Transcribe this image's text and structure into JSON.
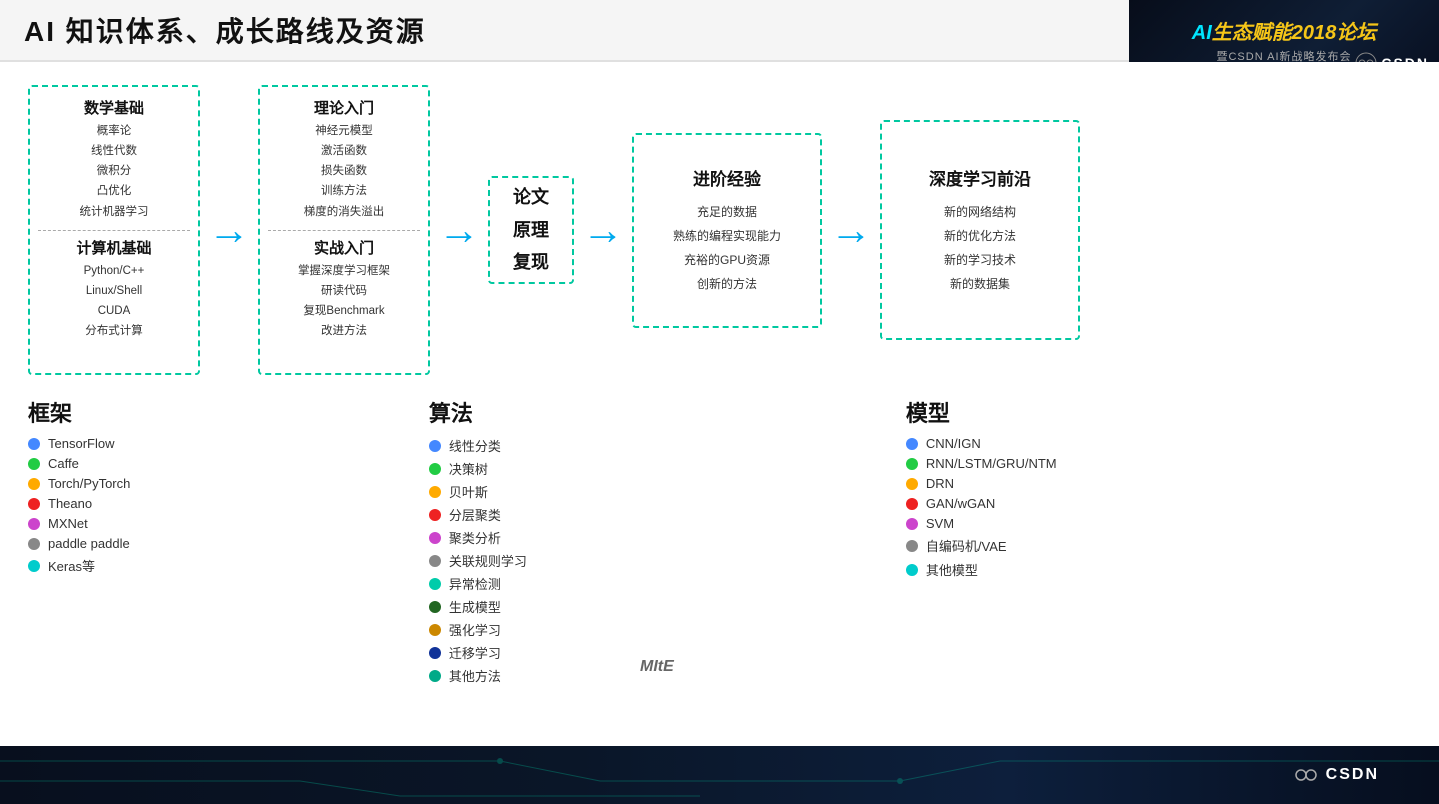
{
  "header": {
    "title": "AI 知识体系、成长路线及资源"
  },
  "logo": {
    "main_text": "AI生态赋能2018论坛",
    "sub_text": "暨CSDN AI新战略发布会",
    "ai_prefix": "AI",
    "year": "2018",
    "forum": "论坛",
    "eco": "生态赋能"
  },
  "flowchart": {
    "box1": {
      "title1": "数学基础",
      "items1": [
        "概率论",
        "线性代数",
        "微积分",
        "凸优化",
        "统计机器学习"
      ],
      "title2": "计算机基础",
      "items2": [
        "Python/C++",
        "Linux/Shell",
        "CUDA",
        "分布式计算"
      ]
    },
    "arrow1": "→",
    "box2": {
      "title1": "理论入门",
      "items1": [
        "神经元模型",
        "激活函数",
        "损失函数",
        "训练方法",
        "梯度的消失溢出"
      ],
      "title2": "实战入门",
      "items2": [
        "掌握深度学习框架",
        "研读代码",
        "复现Benchmark",
        "改进方法"
      ]
    },
    "arrow2": "→",
    "box3": {
      "text": "论文\n原理\n复现"
    },
    "arrow3": "→",
    "box4": {
      "title": "进阶经验",
      "items": [
        "充足的数据",
        "熟练的编程实现能力",
        "充裕的GPU资源",
        "创新的方法"
      ]
    },
    "arrow4": "→",
    "box5": {
      "title": "深度学习前沿",
      "items": [
        "新的网络结构",
        "新的优化方法",
        "新的学习技术",
        "新的数据集"
      ]
    }
  },
  "legend_frameworks": {
    "title": "框架",
    "items": [
      {
        "color": "blue",
        "label": "TensorFlow"
      },
      {
        "color": "green",
        "label": "Caffe"
      },
      {
        "color": "orange",
        "label": "Torch/PyTorch"
      },
      {
        "color": "red",
        "label": "Theano"
      },
      {
        "color": "purple",
        "label": "MXNet"
      },
      {
        "color": "gray",
        "label": "paddle paddle"
      },
      {
        "color": "teal",
        "label": "Keras等"
      }
    ]
  },
  "legend_algorithms": {
    "title": "算法",
    "items": [
      {
        "color": "blue",
        "label": "线性分类"
      },
      {
        "color": "green",
        "label": "决策树"
      },
      {
        "color": "orange",
        "label": "贝叶斯"
      },
      {
        "color": "red",
        "label": "分层聚类"
      },
      {
        "color": "purple",
        "label": "聚类分析"
      },
      {
        "color": "gray",
        "label": "关联规则学习"
      },
      {
        "color": "teal",
        "label": "异常检测"
      },
      {
        "color": "darkgreen",
        "label": "生成模型"
      },
      {
        "color": "darkorange",
        "label": "强化学习"
      },
      {
        "color": "darkblue",
        "label": "迁移学习"
      },
      {
        "color": "teal2",
        "label": "其他方法"
      }
    ]
  },
  "legend_models": {
    "title": "模型",
    "items": [
      {
        "color": "blue",
        "label": "CNN/IGN"
      },
      {
        "color": "green",
        "label": "RNN/LSTM/GRU/NTM"
      },
      {
        "color": "orange",
        "label": "DRN"
      },
      {
        "color": "red",
        "label": "GAN/wGAN"
      },
      {
        "color": "purple",
        "label": "SVM"
      },
      {
        "color": "gray",
        "label": "自编码机/VAE"
      },
      {
        "color": "teal",
        "label": "其他模型"
      }
    ]
  },
  "mit_label": "MItE",
  "csdn": {
    "label": "CSDN"
  }
}
